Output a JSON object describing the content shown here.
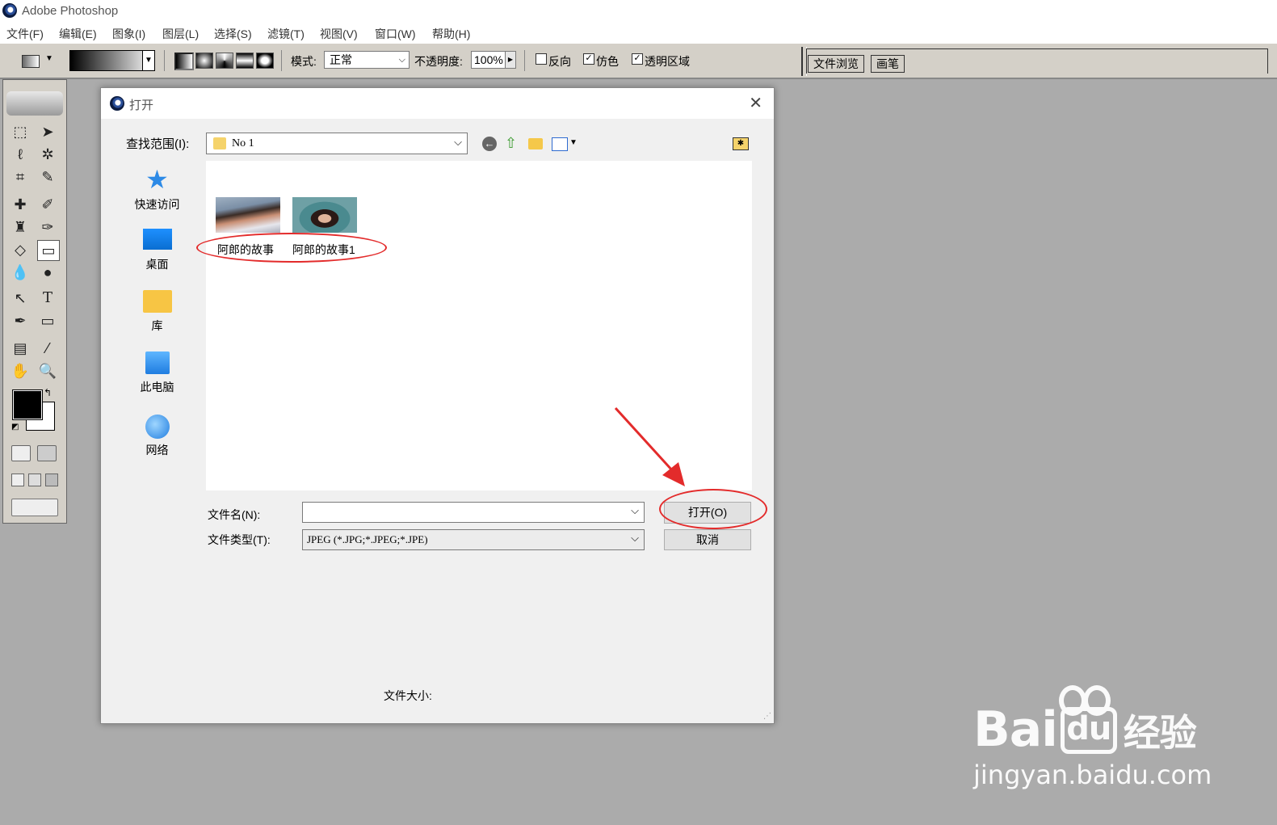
{
  "app": {
    "title": "Adobe Photoshop"
  },
  "menu": [
    "文件(F)",
    "编辑(E)",
    "图象(I)",
    "图层(L)",
    "选择(S)",
    "滤镜(T)",
    "视图(V)",
    "窗口(W)",
    "帮助(H)"
  ],
  "options": {
    "mode_label": "模式:",
    "mode_value": "正常",
    "opacity_label": "不透明度:",
    "opacity_value": "100%",
    "reverse_label": "反向",
    "dither_label": "仿色",
    "transparency_label": "透明区域",
    "reverse_checked": false,
    "dither_checked": true,
    "transparency_checked": true,
    "palette_tabs": [
      "文件浏览",
      "画笔"
    ]
  },
  "dialog": {
    "title": "打开",
    "lookin_label": "查找范围(I):",
    "lookin_value": "No 1",
    "places": [
      "快速访问",
      "桌面",
      "库",
      "此电脑",
      "网络"
    ],
    "files": [
      {
        "name": "阿郎的故事"
      },
      {
        "name": "阿郎的故事1"
      }
    ],
    "filename_label": "文件名(N):",
    "filename_value": "",
    "filetype_label": "文件类型(T):",
    "filetype_value": "JPEG (*.JPG;*.JPEG;*.JPE)",
    "open_button": "打开(O)",
    "cancel_button": "取消",
    "filesize_label": "文件大小:"
  },
  "watermark": {
    "brand": "Bai",
    "brand_du": "du",
    "brand_cn": "经验",
    "url": "jingyan.baidu.com"
  },
  "colors": {
    "annotation": "#e32b2b",
    "background": "#ababab"
  }
}
